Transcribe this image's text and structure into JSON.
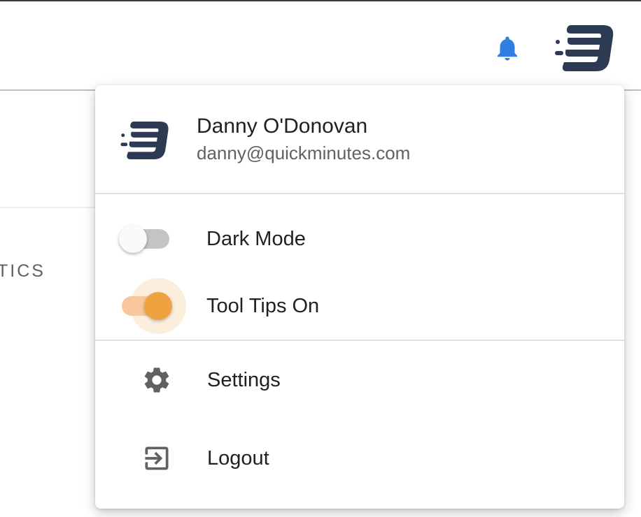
{
  "notifications": {
    "icon": "bell-icon",
    "color": "#2f7fe3"
  },
  "brand": {
    "logo": "brand-logo-icon",
    "color": "#2d3a54"
  },
  "background": {
    "section_label": "TICS"
  },
  "user": {
    "name": "Danny O'Donovan",
    "email": "danny@quickminutes.com"
  },
  "toggles": [
    {
      "label": "Dark Mode",
      "on": false
    },
    {
      "label": "Tool Tips On",
      "on": true,
      "accent_color": "#f0a140"
    }
  ],
  "menu_items": [
    {
      "label": "Settings",
      "icon": "gear-icon"
    },
    {
      "label": "Logout",
      "icon": "logout-icon"
    }
  ]
}
